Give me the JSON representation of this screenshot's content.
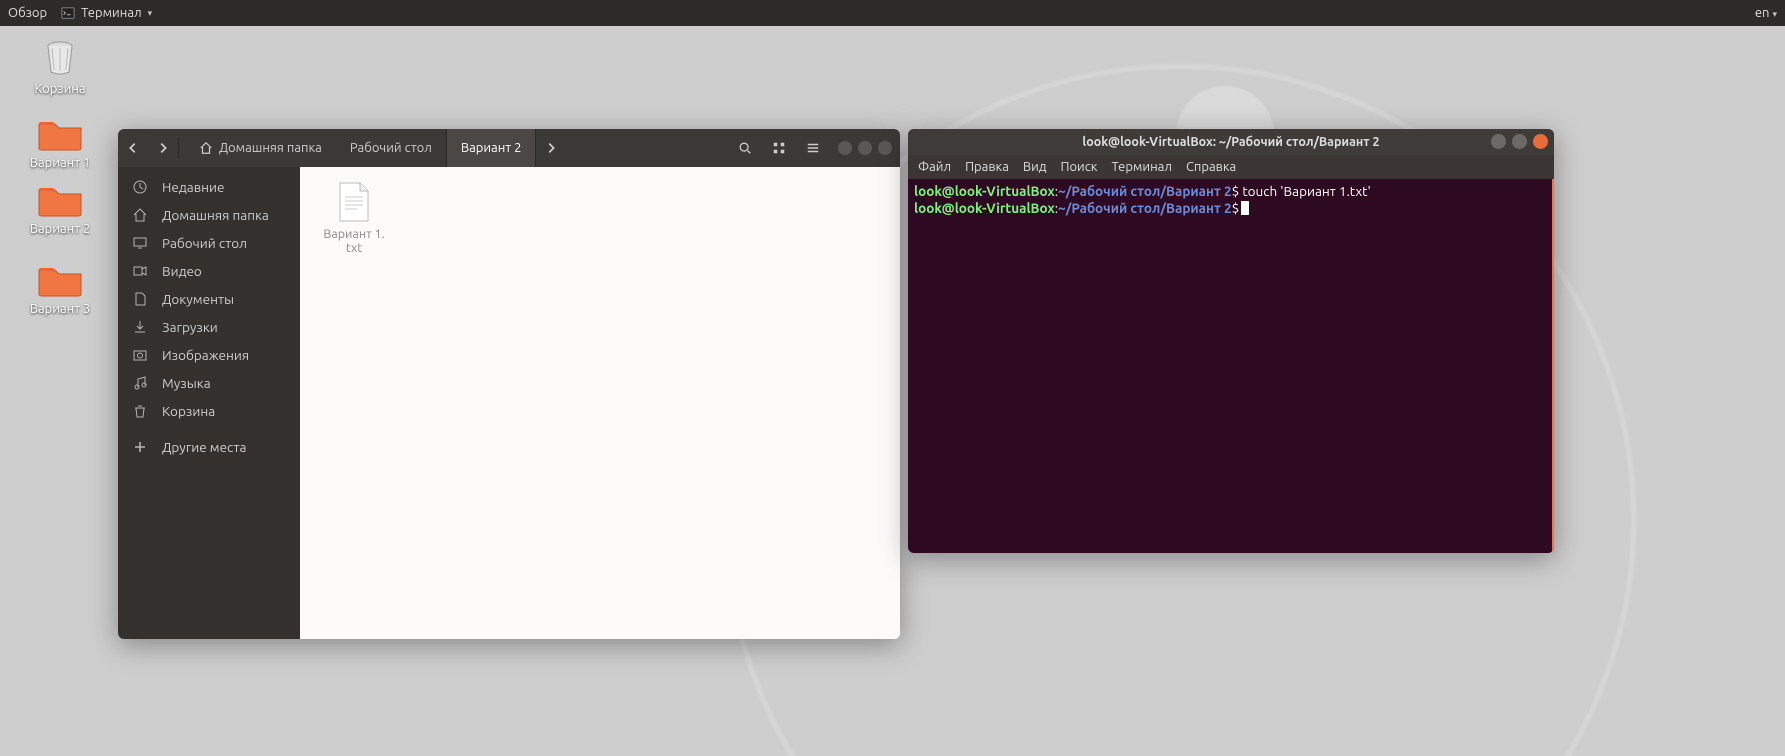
{
  "topbar": {
    "overview": "Обзор",
    "app_name": "Терминал",
    "lang": "en"
  },
  "desktop": {
    "trash": "Корзина",
    "folders": [
      "Вариант 1",
      "Вариант 2",
      "Вариант 3"
    ]
  },
  "nautilus": {
    "breadcrumbs": {
      "home": "Домашняя папка",
      "desktop": "Рабочий стол",
      "current": "Вариант 2"
    },
    "sidebar": {
      "recent": "Недавние",
      "home": "Домашняя папка",
      "desktop": "Рабочий стол",
      "videos": "Видео",
      "documents": "Документы",
      "downloads": "Загрузки",
      "pictures": "Изображения",
      "music": "Музыка",
      "trash": "Корзина",
      "other": "Другие места"
    },
    "file": {
      "name": "Вариант 1.",
      "ext": "txt"
    }
  },
  "terminal": {
    "title": "look@look-VirtualBox: ~/Рабочий стол/Вариант 2",
    "menu": {
      "file": "Файл",
      "edit": "Правка",
      "view": "Вид",
      "search": "Поиск",
      "terminal": "Терминал",
      "help": "Справка"
    },
    "prompt_user": "look@look-VirtualBox",
    "prompt_sep": ":",
    "prompt_path_tilde": "~",
    "prompt_path_rest": "/Рабочий стол/Вариант 2",
    "prompt_dollar": "$",
    "cmd1": " touch 'Вариант 1.txt'"
  }
}
